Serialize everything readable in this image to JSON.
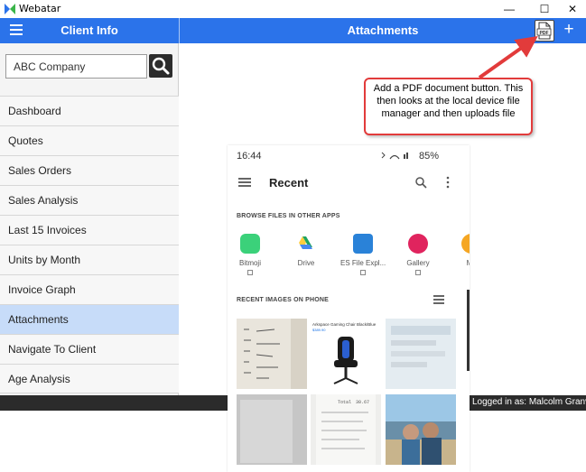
{
  "window": {
    "title": "Webatar",
    "controls": {
      "minimize": "—",
      "maximize": "☐",
      "close": "✕"
    }
  },
  "header": {
    "left_title": "Client Info",
    "right_title": "Attachments",
    "plus": "+",
    "pdf_icon_text": "PDF"
  },
  "search": {
    "value": "ABC Company"
  },
  "menu": {
    "items": [
      {
        "label": "Dashboard"
      },
      {
        "label": "Quotes"
      },
      {
        "label": "Sales Orders"
      },
      {
        "label": "Sales Analysis"
      },
      {
        "label": "Last 15 Invoices"
      },
      {
        "label": "Units by Month"
      },
      {
        "label": "Invoice Graph"
      },
      {
        "label": "Attachments",
        "active": true
      },
      {
        "label": "Navigate To Client"
      },
      {
        "label": "Age Analysis"
      }
    ]
  },
  "status": {
    "logged_in": "Logged in as: Malcolm Granville"
  },
  "callout": {
    "text": "Add a PDF document button. This then looks at the local device file manager and then uploads file"
  },
  "phone": {
    "time": "16:44",
    "battery": "85%",
    "title": "Recent",
    "browse_label": "BROWSE FILES IN OTHER APPS",
    "recent_images_label": "RECENT IMAGES ON PHONE",
    "apps": [
      {
        "label": "Bitmoji",
        "color": "#3bd17a"
      },
      {
        "label": "Drive",
        "color": "#ffffff"
      },
      {
        "label": "ES File Expl...",
        "color": "#2a82d8"
      },
      {
        "label": "Gallery",
        "color": "#e0245e"
      },
      {
        "label": "My",
        "color": "#f5a623"
      }
    ],
    "thumb_texts": {
      "chair": "Arkspace Gaming Chair Black/Blue",
      "chair_price": "$389.90",
      "receipt_total": "Total",
      "receipt_value": "30.67"
    }
  },
  "colors": {
    "header_blue": "#2b73ea",
    "active_item": "#c7dcf9",
    "callout_red": "#e23b3b"
  }
}
